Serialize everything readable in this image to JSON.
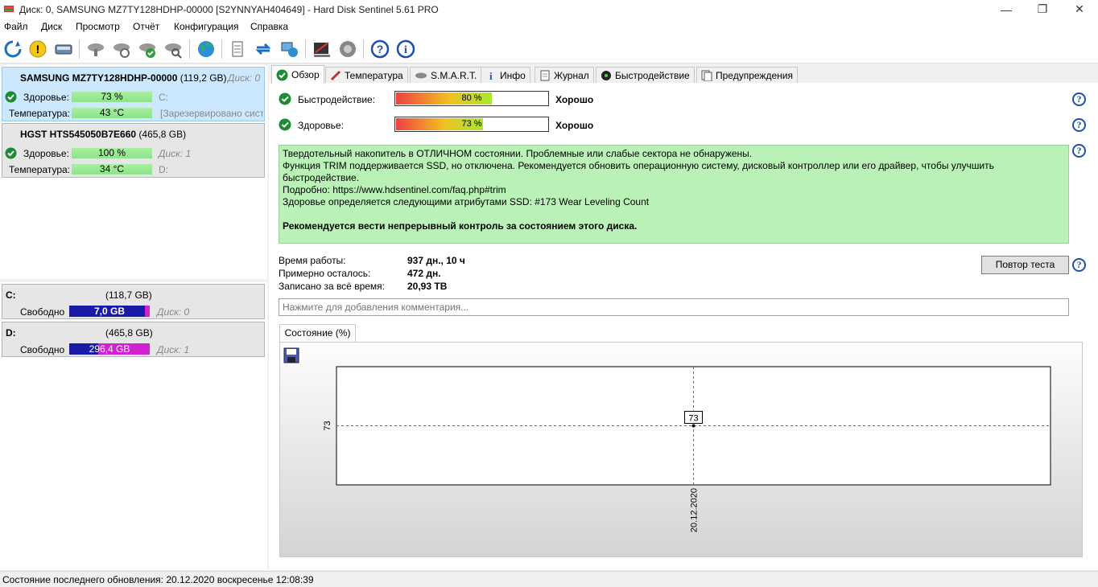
{
  "window": {
    "title": "Диск: 0, SAMSUNG MZ7TY128HDHP-00000 [S2YNNYAH404649]  -  Hard Disk Sentinel 5.61 PRO"
  },
  "menu": [
    "Файл",
    "Диск",
    "Просмотр",
    "Отчёт",
    "Конфигурация",
    "Справка"
  ],
  "toolbar_icons": [
    "refresh-icon",
    "alert-icon",
    "disk-icon",
    "disk-gray-icon",
    "disk-refresh-icon",
    "disk-check-icon",
    "disk-search-icon",
    "globe-icon",
    "report-icon",
    "transfer-icon",
    "network-icon",
    "surface-test-icon",
    "sound-icon",
    "help-icon",
    "info-icon"
  ],
  "disks": [
    {
      "name": "SAMSUNG MZ7TY128HDHP-00000",
      "size": "(119,2 GB)",
      "disk_no": "Диск: 0",
      "health_label": "Здоровье:",
      "health": "73 %",
      "health_pct": 73,
      "temp_label": "Температура:",
      "temp": "43 °C",
      "temp_pct": 43,
      "drive_letters": "C:",
      "reserved": "[Зарезервировано системой]"
    },
    {
      "name": "HGST HTS545050B7E660",
      "size": "(465,8 GB)",
      "disk_no": "Диск: 1",
      "health_label": "Здоровье:",
      "health": "100 %",
      "health_pct": 100,
      "temp_label": "Температура:",
      "temp": "34 °C",
      "temp_pct": 34,
      "drive_letters": "D:"
    }
  ],
  "partitions": [
    {
      "letter": "C:",
      "size": "(118,7 GB)",
      "free_label": "Свободно",
      "free": "7,0 GB",
      "free_pct": 6,
      "disk_no": "Диск: 0"
    },
    {
      "letter": "D:",
      "size": "(465,8 GB)",
      "free_label": "Свободно",
      "free": "296,4 GB",
      "free_pct": 64,
      "disk_no": "Диск: 1"
    }
  ],
  "tabs": [
    "Обзор",
    "Температура",
    "S.M.A.R.T.",
    "Инфо",
    "Журнал",
    "Быстродействие",
    "Предупреждения"
  ],
  "overview": {
    "perf_label": "Быстродействие:",
    "perf_value": "80 %",
    "perf_pct": 80,
    "perf_status": "Хорошо",
    "health_label": "Здоровье:",
    "health_value": "73 %",
    "health_pct": 73,
    "health_status": "Хорошо",
    "status_lines": [
      "Твердотельный накопитель в ОТЛИЧНОМ состоянии. Проблемные или слабые сектора не обнаружены.",
      "Функция TRIM поддерживается SSD, но отключена. Рекомендуется обновить операционную систему, дисковый контроллер или его драйвер, чтобы улучшить быстродействие.",
      "Подробно: https://www.hdsentinel.com/faq.php#trim",
      "Здоровье определяется следующими атрибутами SSD: #173 Wear Leveling Count"
    ],
    "status_recommend": "Рекомендуется вести непрерывный контроль за состоянием этого диска.",
    "uptime_label": "Время работы:",
    "uptime": "937 дн., 10 ч",
    "remaining_label": "Примерно осталось:",
    "remaining": "472 дн.",
    "written_label": "Записано за всё время:",
    "written": "20,93 TB",
    "retest_button": "Повтор теста",
    "comment_placeholder": "Нажмите для добавления комментария..."
  },
  "chart_tab": "Состояние (%)",
  "chart_data": {
    "type": "line",
    "x": [
      "20.12.2020"
    ],
    "series": [
      {
        "values": [
          73
        ]
      }
    ],
    "ytick": "73",
    "xtick": "20.12.2020",
    "data_label": "73"
  },
  "statusbar": "Состояние последнего обновления: 20.12.2020 воскресенье 12:08:39"
}
